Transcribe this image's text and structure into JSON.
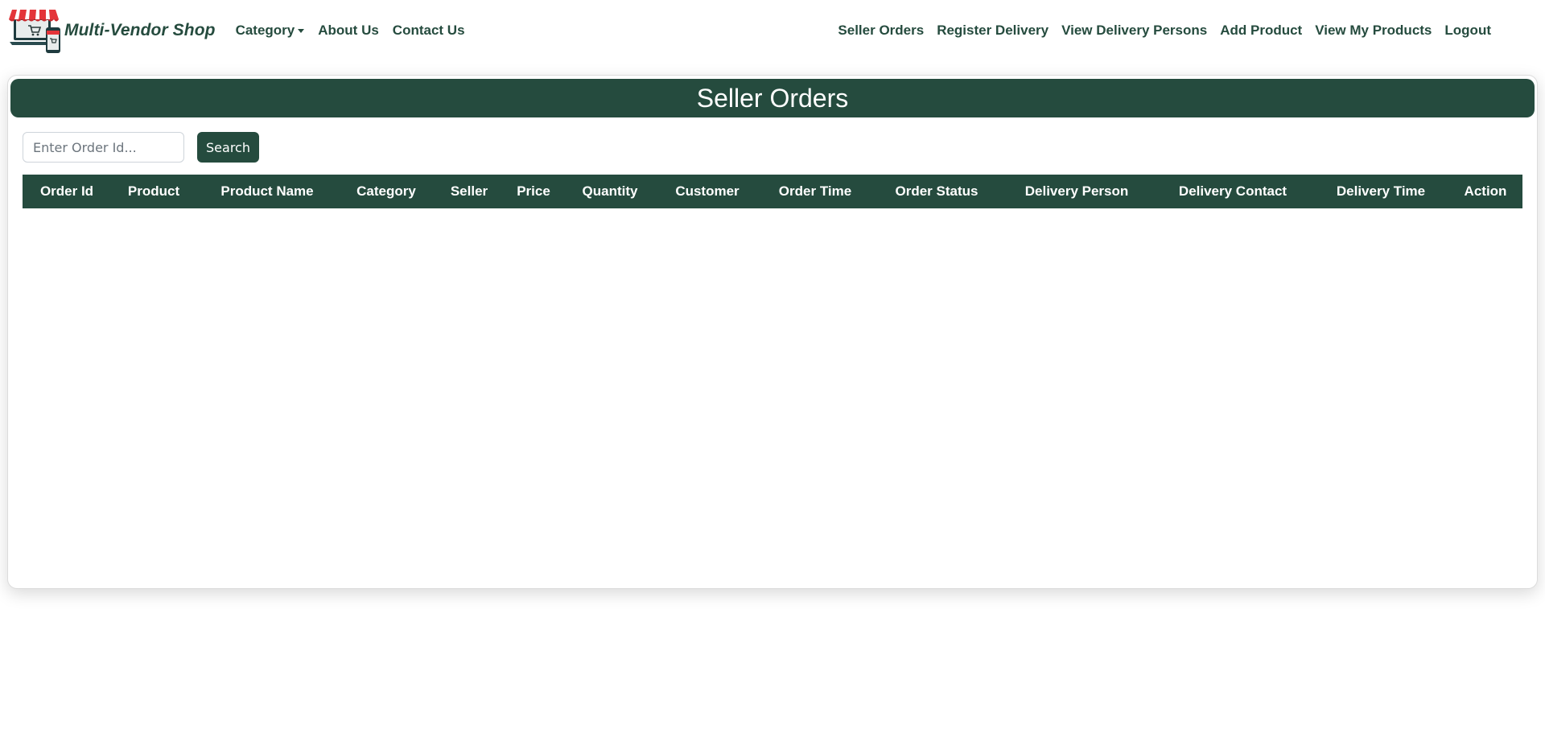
{
  "brand": {
    "name": "Multi-Vendor Shop"
  },
  "nav_left": [
    {
      "label": "Category",
      "dropdown": true
    },
    {
      "label": "About Us"
    },
    {
      "label": "Contact Us"
    }
  ],
  "nav_right": [
    {
      "label": "Seller Orders"
    },
    {
      "label": "Register Delivery"
    },
    {
      "label": "View Delivery Persons"
    },
    {
      "label": "Add Product"
    },
    {
      "label": "View My Products"
    },
    {
      "label": "Logout"
    }
  ],
  "page": {
    "title": "Seller Orders",
    "search": {
      "placeholder": "Enter Order Id...",
      "value": "",
      "button_label": "Search"
    }
  },
  "table": {
    "columns": [
      "Order Id",
      "Product",
      "Product Name",
      "Category",
      "Seller",
      "Price",
      "Quantity",
      "Customer",
      "Order Time",
      "Order Status",
      "Delivery Person",
      "Delivery Contact",
      "Delivery Time",
      "Action"
    ],
    "rows": []
  },
  "colors": {
    "primary": "#254b3e",
    "logo_red": "#e4353a"
  }
}
